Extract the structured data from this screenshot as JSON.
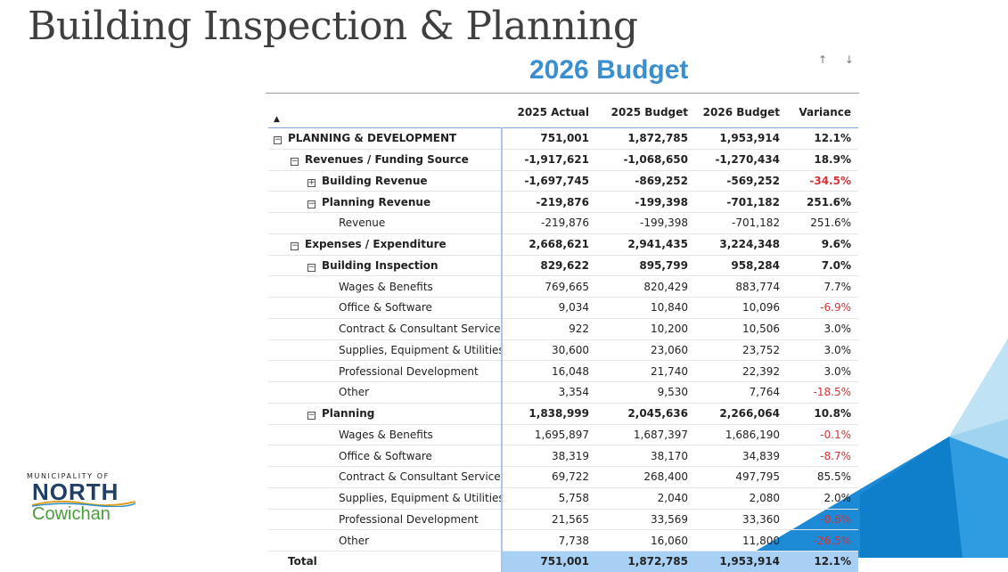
{
  "slide": {
    "title": "Building Inspection & Planning"
  },
  "visual": {
    "title": "2026 Budget",
    "sort_icons": "↑ ↓"
  },
  "table": {
    "sort_indicator": "▲",
    "headers": [
      "",
      "2025 Actual",
      "2025 Budget",
      "2026 Budget",
      "Variance"
    ],
    "rows": [
      {
        "label": "PLANNING & DEVELOPMENT",
        "level": 0,
        "expander": "⊟",
        "bold": true,
        "values": [
          "751,001",
          "1,872,785",
          "1,953,914",
          "12.1%"
        ],
        "negative_variance": false
      },
      {
        "label": "Revenues / Funding Source",
        "level": 1,
        "expander": "⊟",
        "bold": true,
        "values": [
          "-1,917,621",
          "-1,068,650",
          "-1,270,434",
          "18.9%"
        ],
        "negative_variance": false
      },
      {
        "label": "Building Revenue",
        "level": 2,
        "expander": "⊞",
        "bold": true,
        "values": [
          "-1,697,745",
          "-869,252",
          "-569,252",
          "-34.5%"
        ],
        "negative_variance": true
      },
      {
        "label": "Planning Revenue",
        "level": 2,
        "expander": "⊟",
        "bold": true,
        "values": [
          "-219,876",
          "-199,398",
          "-701,182",
          "251.6%"
        ],
        "negative_variance": false
      },
      {
        "label": "Revenue",
        "level": 3,
        "expander": "",
        "bold": false,
        "values": [
          "-219,876",
          "-199,398",
          "-701,182",
          "251.6%"
        ],
        "negative_variance": false
      },
      {
        "label": "Expenses / Expenditure",
        "level": 1,
        "expander": "⊟",
        "bold": true,
        "values": [
          "2,668,621",
          "2,941,435",
          "3,224,348",
          "9.6%"
        ],
        "negative_variance": false
      },
      {
        "label": "Building Inspection",
        "level": 2,
        "expander": "⊟",
        "bold": true,
        "values": [
          "829,622",
          "895,799",
          "958,284",
          "7.0%"
        ],
        "negative_variance": false
      },
      {
        "label": "Wages & Benefits",
        "level": 3,
        "expander": "",
        "bold": false,
        "values": [
          "769,665",
          "820,429",
          "883,774",
          "7.7%"
        ],
        "negative_variance": false
      },
      {
        "label": "Office & Software",
        "level": 3,
        "expander": "",
        "bold": false,
        "values": [
          "9,034",
          "10,840",
          "10,096",
          "-6.9%"
        ],
        "negative_variance": true
      },
      {
        "label": "Contract & Consultant Services",
        "level": 3,
        "expander": "",
        "bold": false,
        "values": [
          "922",
          "10,200",
          "10,506",
          "3.0%"
        ],
        "negative_variance": false
      },
      {
        "label": "Supplies, Equipment & Utilities",
        "level": 3,
        "expander": "",
        "bold": false,
        "values": [
          "30,600",
          "23,060",
          "23,752",
          "3.0%"
        ],
        "negative_variance": false
      },
      {
        "label": "Professional Development",
        "level": 3,
        "expander": "",
        "bold": false,
        "values": [
          "16,048",
          "21,740",
          "22,392",
          "3.0%"
        ],
        "negative_variance": false
      },
      {
        "label": "Other",
        "level": 3,
        "expander": "",
        "bold": false,
        "values": [
          "3,354",
          "9,530",
          "7,764",
          "-18.5%"
        ],
        "negative_variance": true
      },
      {
        "label": "Planning",
        "level": 2,
        "expander": "⊟",
        "bold": true,
        "values": [
          "1,838,999",
          "2,045,636",
          "2,266,064",
          "10.8%"
        ],
        "negative_variance": false
      },
      {
        "label": "Wages & Benefits",
        "level": 3,
        "expander": "",
        "bold": false,
        "values": [
          "1,695,897",
          "1,687,397",
          "1,686,190",
          "-0.1%"
        ],
        "negative_variance": true
      },
      {
        "label": "Office & Software",
        "level": 3,
        "expander": "",
        "bold": false,
        "values": [
          "38,319",
          "38,170",
          "34,839",
          "-8.7%"
        ],
        "negative_variance": true
      },
      {
        "label": "Contract & Consultant Services",
        "level": 3,
        "expander": "",
        "bold": false,
        "values": [
          "69,722",
          "268,400",
          "497,795",
          "85.5%"
        ],
        "negative_variance": false
      },
      {
        "label": "Supplies, Equipment & Utilities",
        "level": 3,
        "expander": "",
        "bold": false,
        "values": [
          "5,758",
          "2,040",
          "2,080",
          "2.0%"
        ],
        "negative_variance": false
      },
      {
        "label": "Professional Development",
        "level": 3,
        "expander": "",
        "bold": false,
        "values": [
          "21,565",
          "33,569",
          "33,360",
          "-0.6%"
        ],
        "negative_variance": true
      },
      {
        "label": "Other",
        "level": 3,
        "expander": "",
        "bold": false,
        "values": [
          "7,738",
          "16,060",
          "11,800",
          "-26.5%"
        ],
        "negative_variance": true
      }
    ],
    "total": {
      "label": "Total",
      "values": [
        "751,001",
        "1,872,785",
        "1,953,914",
        "12.1%"
      ]
    }
  },
  "logo": {
    "line1": "MUNICIPALITY OF",
    "line2": "NORTH",
    "line3": "Cowichan"
  },
  "colors": {
    "accent": "#3a8fd0",
    "negative": "#d13438",
    "total_fill": "#a8d0f4"
  }
}
